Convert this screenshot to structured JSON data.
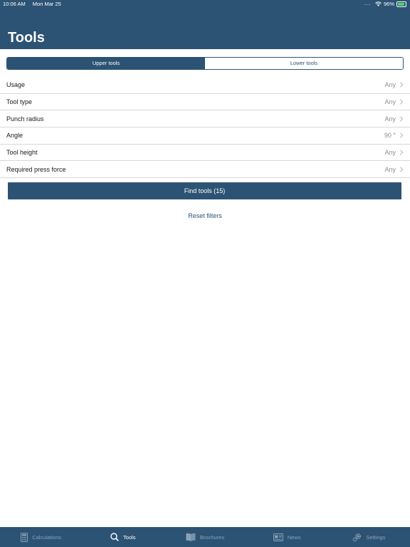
{
  "status_bar": {
    "time": "10:06 AM",
    "date": "Mon Mar 25",
    "signal": ".....",
    "battery": "96%"
  },
  "header": {
    "title": "Tools"
  },
  "segmented": {
    "upper": "Upper tools",
    "lower": "Lower tools",
    "selected": "Upper tools"
  },
  "filters": [
    {
      "label": "Usage",
      "value": "Any"
    },
    {
      "label": "Tool type",
      "value": "Any"
    },
    {
      "label": "Punch radius",
      "value": "Any"
    },
    {
      "label": "Angle",
      "value": "90 °"
    },
    {
      "label": "Tool height",
      "value": "Any"
    },
    {
      "label": "Required press force",
      "value": "Any"
    }
  ],
  "find_button": "Find tools (15)",
  "reset_link": "Reset filters",
  "tabbar": {
    "items": [
      {
        "label": "Calculations",
        "icon": "calculator-icon",
        "active": false
      },
      {
        "label": "Tools",
        "icon": "search-icon",
        "active": true
      },
      {
        "label": "Brochures",
        "icon": "book-icon",
        "active": false
      },
      {
        "label": "News",
        "icon": "newspaper-icon",
        "active": false
      },
      {
        "label": "Settings",
        "icon": "gear-icon",
        "active": false
      }
    ]
  },
  "colors": {
    "brand": "#2c5374",
    "inactive_tab": "#8aa2b7",
    "secondary_text": "#8e8e93",
    "battery": "#4cd964"
  }
}
